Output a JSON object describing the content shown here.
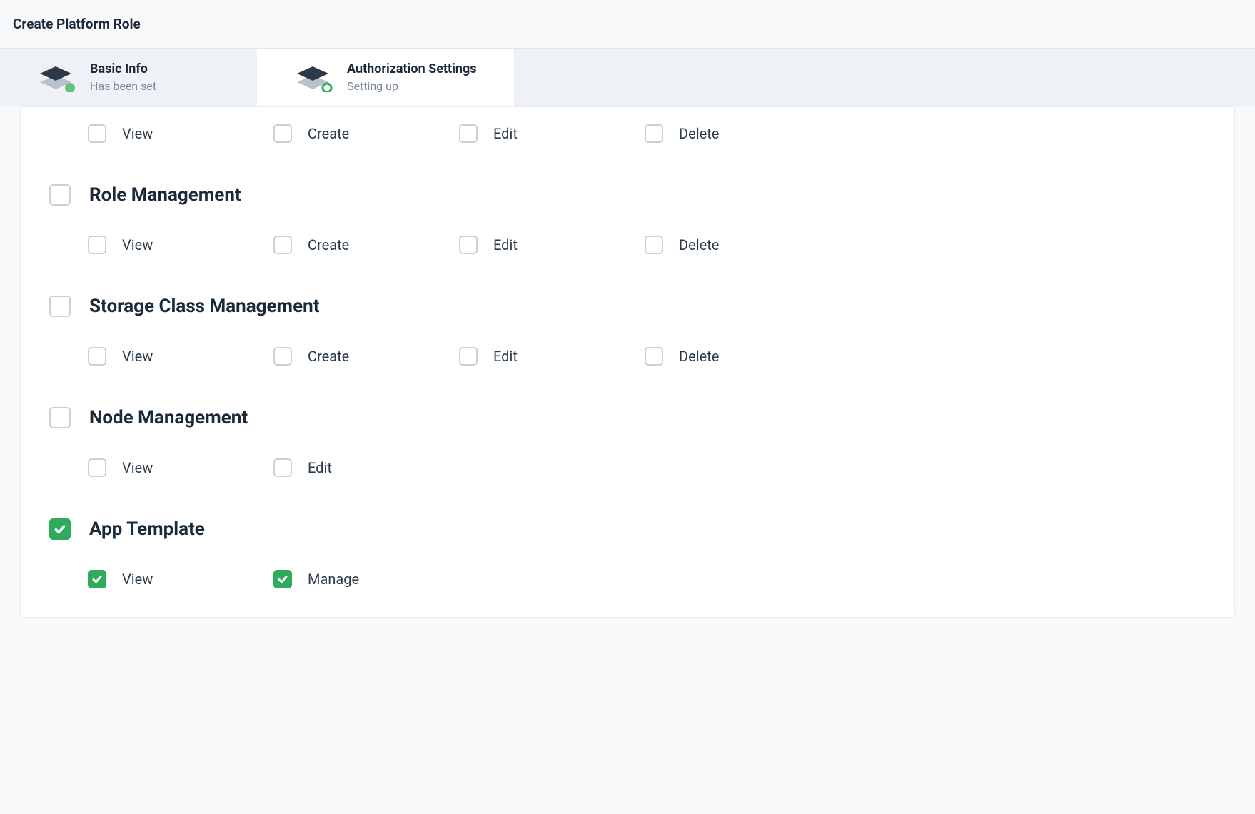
{
  "header": {
    "title": "Create Platform Role"
  },
  "steps": [
    {
      "title": "Basic Info",
      "subtitle": "Has been set",
      "status": "done",
      "active": false
    },
    {
      "title": "Authorization Settings",
      "subtitle": "Setting up",
      "status": "progress",
      "active": true
    }
  ],
  "colors": {
    "accent_green": "#2eab5b",
    "status_done_dot": "#64c27b",
    "text_primary": "#1a2a3a",
    "text_muted": "#7a8a99",
    "border": "#e1e6eb",
    "bg_page": "#f7f9fb",
    "bg_inactive_step": "#eef1f5"
  },
  "permission_labels": {
    "view": "View",
    "create": "Create",
    "edit": "Edit",
    "delete": "Delete",
    "manage": "Manage"
  },
  "sections": [
    {
      "id": "scrolled-top",
      "title": "",
      "group_checked": false,
      "items": [
        {
          "key": "view",
          "checked": false
        },
        {
          "key": "create",
          "checked": false
        },
        {
          "key": "edit",
          "checked": false
        },
        {
          "key": "delete",
          "checked": false
        }
      ]
    },
    {
      "id": "role-management",
      "title": "Role Management",
      "group_checked": false,
      "items": [
        {
          "key": "view",
          "checked": false
        },
        {
          "key": "create",
          "checked": false
        },
        {
          "key": "edit",
          "checked": false
        },
        {
          "key": "delete",
          "checked": false
        }
      ]
    },
    {
      "id": "storage-class-management",
      "title": "Storage Class Management",
      "group_checked": false,
      "items": [
        {
          "key": "view",
          "checked": false
        },
        {
          "key": "create",
          "checked": false
        },
        {
          "key": "edit",
          "checked": false
        },
        {
          "key": "delete",
          "checked": false
        }
      ]
    },
    {
      "id": "node-management",
      "title": "Node Management",
      "group_checked": false,
      "items": [
        {
          "key": "view",
          "checked": false
        },
        {
          "key": "edit",
          "checked": false
        }
      ]
    },
    {
      "id": "app-template",
      "title": "App Template",
      "group_checked": true,
      "items": [
        {
          "key": "view",
          "checked": true
        },
        {
          "key": "manage",
          "checked": true
        }
      ]
    }
  ]
}
